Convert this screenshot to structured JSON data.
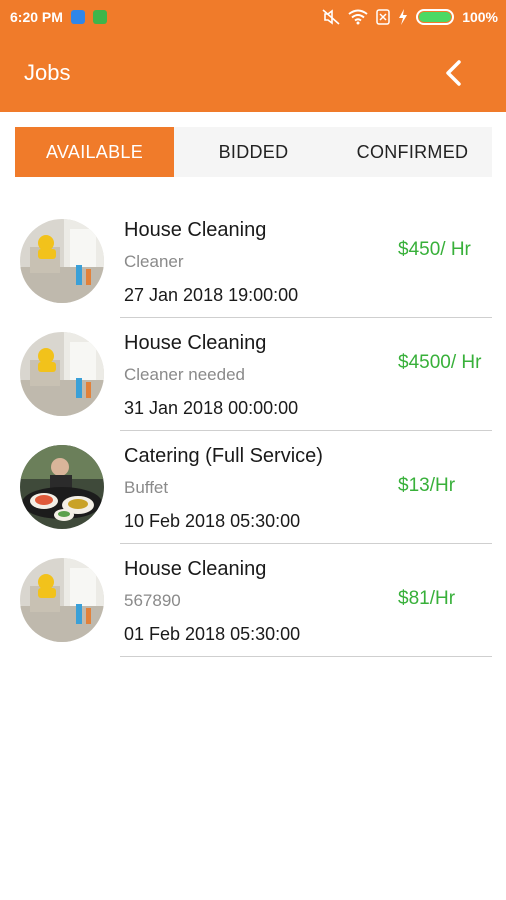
{
  "status_bar": {
    "time": "6:20 PM",
    "battery": "100%"
  },
  "header": {
    "title": "Jobs",
    "back_icon": "chevron-left-icon"
  },
  "tabs": [
    {
      "label": "AVAILABLE",
      "active": true
    },
    {
      "label": "BIDDED",
      "active": false
    },
    {
      "label": "CONFIRMED",
      "active": false
    }
  ],
  "jobs": [
    {
      "title": "House Cleaning",
      "subtitle": "Cleaner",
      "date": "27 Jan 2018 19:00:00",
      "price": "$450/ Hr",
      "image": "cleaning"
    },
    {
      "title": "House Cleaning",
      "subtitle": "Cleaner needed",
      "date": "31 Jan 2018 00:00:00",
      "price": "$4500/ Hr",
      "image": "cleaning"
    },
    {
      "title": "Catering (Full Service)",
      "subtitle": "Buffet",
      "date": "10 Feb 2018 05:30:00",
      "price": "$13/Hr",
      "image": "catering"
    },
    {
      "title": "House Cleaning",
      "subtitle": "567890",
      "date": "01 Feb 2018 05:30:00",
      "price": "$81/Hr",
      "image": "cleaning"
    }
  ],
  "colors": {
    "accent": "#f07b2a",
    "price": "#38b03a"
  }
}
